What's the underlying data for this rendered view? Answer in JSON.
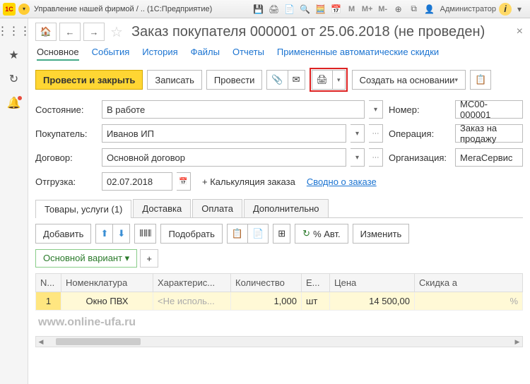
{
  "titlebar": {
    "logo": "1С",
    "title": "Управление нашей фирмой / .. (1С:Предприятие)",
    "m": "M",
    "mplus": "M+",
    "mminus": "M-",
    "user_icon": "👤",
    "user": "Администратор",
    "info": "i"
  },
  "page": {
    "title": "Заказ покупателя 000001 от 25.06.2018 (не проведен)"
  },
  "link_tabs": {
    "main": "Основное",
    "events": "События",
    "history": "История",
    "files": "Файлы",
    "reports": "Отчеты",
    "discounts": "Примененные автоматические скидки"
  },
  "toolbar": {
    "post_close": "Провести и закрыть",
    "save": "Записать",
    "post": "Провести",
    "create_based": "Создать на основании"
  },
  "form": {
    "state_lbl": "Состояние:",
    "state_val": "В работе",
    "number_lbl": "Номер:",
    "number_val": "МС00-000001",
    "buyer_lbl": "Покупатель:",
    "buyer_val": "Иванов ИП",
    "operation_lbl": "Операция:",
    "operation_val": "Заказ на продажу",
    "contract_lbl": "Договор:",
    "contract_val": "Основной договор",
    "org_lbl": "Организация:",
    "org_val": "МегаСервис",
    "ship_lbl": "Отгрузка:",
    "ship_val": "02.07.2018",
    "calc": "+ Калькуляция заказа",
    "summary": "Сводно о заказе"
  },
  "sub_tabs": {
    "goods": "Товары, услуги (1)",
    "delivery": "Доставка",
    "payment": "Оплата",
    "extra": "Дополнительно"
  },
  "grid_tb": {
    "add": "Добавить",
    "pick": "Подобрать",
    "auto_pct": "% Авт.",
    "change": "Изменить",
    "variant": "Основной вариант",
    "plus": "+"
  },
  "grid": {
    "headers": {
      "n": "N...",
      "nom": "Номенклатура",
      "char": "Характерис...",
      "qty": "Количество",
      "unit": "Е...",
      "price": "Цена",
      "disc": "Скидка а"
    },
    "rows": [
      {
        "n": "1",
        "nom": "Окно ПВХ",
        "char": "<Не исполь...",
        "qty": "1,000",
        "unit": "шт",
        "price": "14 500,00",
        "disc": "%"
      }
    ]
  },
  "watermark": "www.online-ufa.ru"
}
